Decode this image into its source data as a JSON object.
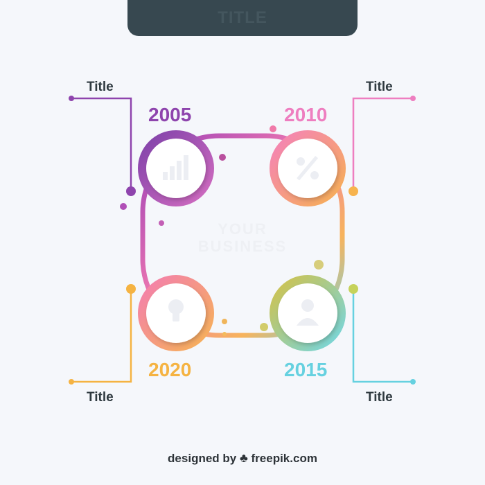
{
  "header": {
    "text": "TITLE"
  },
  "center": {
    "line1": "YOUR",
    "line2": "BUSINESS"
  },
  "milestones": [
    {
      "year": "2005",
      "title": "Title",
      "color": "#8e44ad"
    },
    {
      "year": "2010",
      "title": "Title",
      "color": "#ee7ec0"
    },
    {
      "year": "2015",
      "title": "Title",
      "color": "#66d1e0"
    },
    {
      "year": "2020",
      "title": "Title",
      "color": "#f5b342"
    }
  ],
  "icons": [
    "bar-chart-icon",
    "percent-icon",
    "user-icon",
    "lightbulb-icon"
  ],
  "footer": {
    "prefix": "designed by",
    "brand": "freepik.com"
  }
}
